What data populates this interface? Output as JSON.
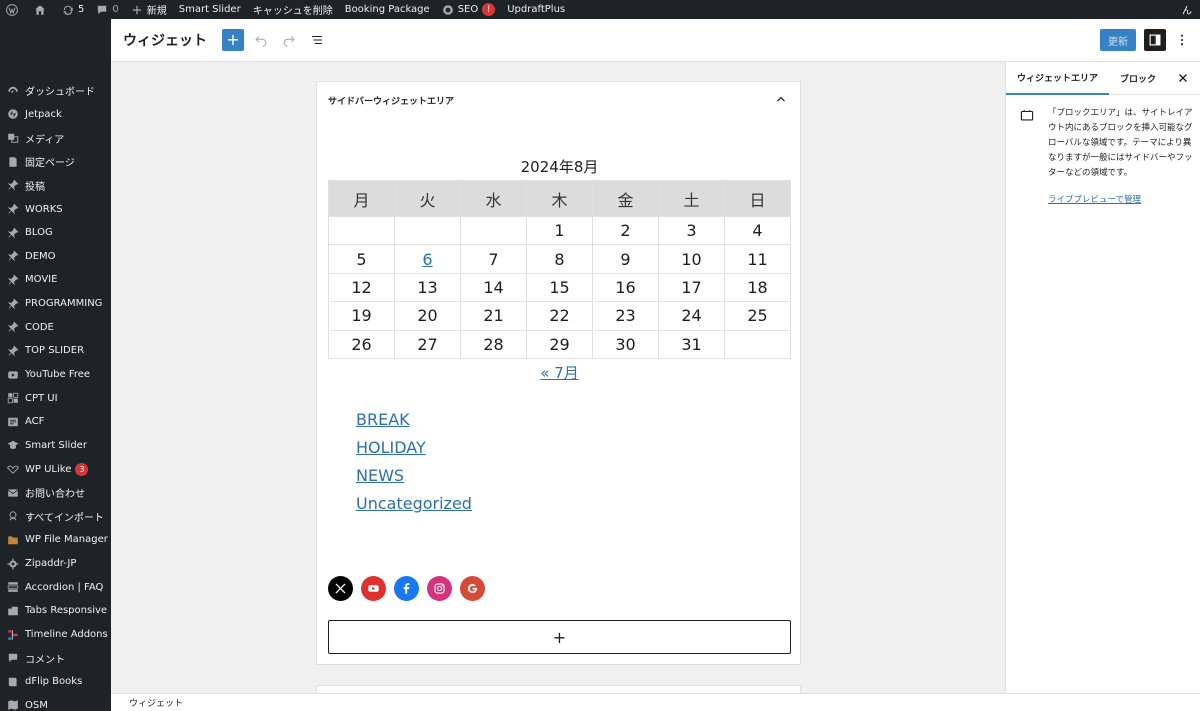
{
  "adminbar": {
    "updates_count": "5",
    "comments_count": "0",
    "new_label": "新規",
    "smart_slider": "Smart Slider",
    "clear_cache": "キャッシュを削除",
    "booking": "Booking Package",
    "seo": "SEO",
    "seo_badge": "!",
    "updraft": "UpdraftPlus",
    "right_text": "ん"
  },
  "sidebar": {
    "items": [
      {
        "label": "ダッシュボード",
        "icon": "dashboard-icon"
      },
      {
        "label": "Jetpack",
        "icon": "jetpack-icon"
      },
      {
        "label": "メディア",
        "icon": "media-icon"
      },
      {
        "label": "固定ページ",
        "icon": "page-icon"
      },
      {
        "label": "投稿",
        "icon": "pin-icon"
      },
      {
        "label": "WORKS",
        "icon": "pin-icon"
      },
      {
        "label": "BLOG",
        "icon": "pin-icon"
      },
      {
        "label": "DEMO",
        "icon": "pin-icon"
      },
      {
        "label": "MOVIE",
        "icon": "pin-icon"
      },
      {
        "label": "PROGRAMMING",
        "icon": "pin-icon"
      },
      {
        "label": "CODE",
        "icon": "pin-icon"
      },
      {
        "label": "TOP SLIDER",
        "icon": "pin-icon"
      },
      {
        "label": "YouTube Free",
        "icon": "youtube-icon"
      },
      {
        "label": "CPT UI",
        "icon": "cpt-icon"
      },
      {
        "label": "ACF",
        "icon": "acf-icon"
      },
      {
        "label": "Smart Slider",
        "icon": "slider-icon"
      },
      {
        "label": "WP ULike",
        "icon": "ulike-icon",
        "badge": "3"
      },
      {
        "label": "お問い合わせ",
        "icon": "mail-icon"
      },
      {
        "label": "すべてインポート",
        "icon": "import-icon"
      },
      {
        "label": "WP File Manager",
        "icon": "folder-icon"
      },
      {
        "label": "Zipaddr-JP",
        "icon": "gear-icon"
      },
      {
        "label": "Accordion | FAQ",
        "icon": "accordion-icon"
      },
      {
        "label": "Tabs Responsive",
        "icon": "tabs-icon"
      },
      {
        "label": "Timeline Addons",
        "icon": "timeline-icon"
      },
      {
        "label": "コメント",
        "icon": "comment-icon"
      },
      {
        "label": "dFlip Books",
        "icon": "book-icon"
      },
      {
        "label": "OSM",
        "icon": "map-icon"
      }
    ]
  },
  "header": {
    "title": "ウィジェット",
    "add_label": "+",
    "update_label": "更新"
  },
  "widget_area": {
    "title": "サイドバーウィジェットエリア",
    "calendar": {
      "caption": "2024年8月",
      "weekdays": [
        "月",
        "火",
        "水",
        "木",
        "金",
        "土",
        "日"
      ],
      "rows": [
        [
          "",
          "",
          "",
          "1",
          "2",
          "3",
          "4"
        ],
        [
          "5",
          "6",
          "7",
          "8",
          "9",
          "10",
          "11"
        ],
        [
          "12",
          "13",
          "14",
          "15",
          "16",
          "17",
          "18"
        ],
        [
          "19",
          "20",
          "21",
          "22",
          "23",
          "24",
          "25"
        ],
        [
          "26",
          "27",
          "28",
          "29",
          "30",
          "31",
          ""
        ]
      ],
      "linked_day": "6",
      "prev_link": "« 7月"
    },
    "categories": [
      "BREAK",
      "HOLIDAY",
      "NEWS",
      "Uncategorized"
    ],
    "social": [
      {
        "icon": "x-icon",
        "color": "#000000"
      },
      {
        "icon": "youtube-icon",
        "color": "#e02f2f"
      },
      {
        "icon": "facebook-icon",
        "color": "#1778f2"
      },
      {
        "icon": "instagram-icon",
        "color": "#d6317a"
      },
      {
        "icon": "google-icon",
        "color": "#d84a38"
      }
    ],
    "appender_label": "+"
  },
  "panel": {
    "tabs": [
      "ウィジェットエリア",
      "ブロック"
    ],
    "description": "「ブロックエリア」は、サイトレイアウト内にあるブロックを挿入可能なグローバルな領域です。テーマにより異なりますが一般にはサイドバーやフッターなどの領域です。",
    "link": "ライブプレビューで管理"
  },
  "footer": {
    "breadcrumb": "ウィジェット"
  },
  "colors": {
    "admin_dark": "#1d2327",
    "accent": "#3582c4",
    "link": "#2c6fb5"
  }
}
